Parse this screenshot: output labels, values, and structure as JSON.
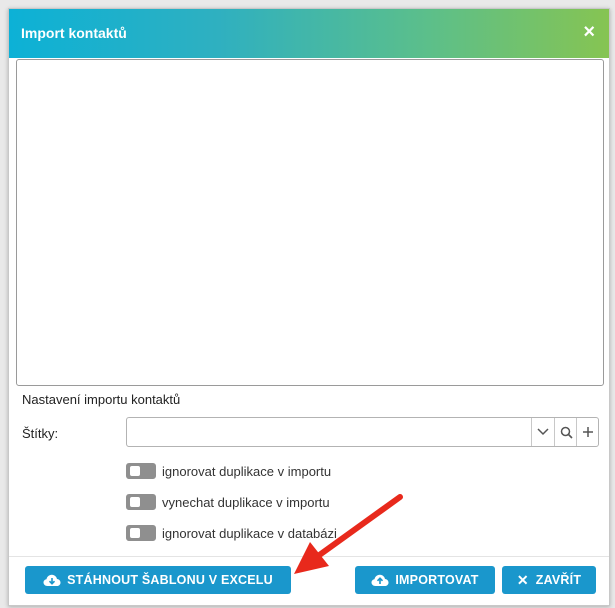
{
  "dialog": {
    "title": "Import kontaktů",
    "close_glyph": "×"
  },
  "settings": {
    "title": "Nastavení importu kontaktů",
    "tags_label": "Štítky:",
    "tags_value": "",
    "options": [
      {
        "label": "ignorovat duplikace v importu",
        "checked": false
      },
      {
        "label": "vynechat duplikace v importu",
        "checked": false
      },
      {
        "label": "ignorovat duplikace v databázi",
        "checked": false
      }
    ]
  },
  "buttons": {
    "download_template": "STÁHNOUT ŠABLONU V EXCELU",
    "import": "IMPORTOVAT",
    "close": "ZAVŘÍT"
  },
  "colors": {
    "primary_button": "#1a97cc",
    "annotation_arrow": "#e8291c",
    "header_gradient_start": "#0cb1d6",
    "header_gradient_end": "#86c452"
  }
}
